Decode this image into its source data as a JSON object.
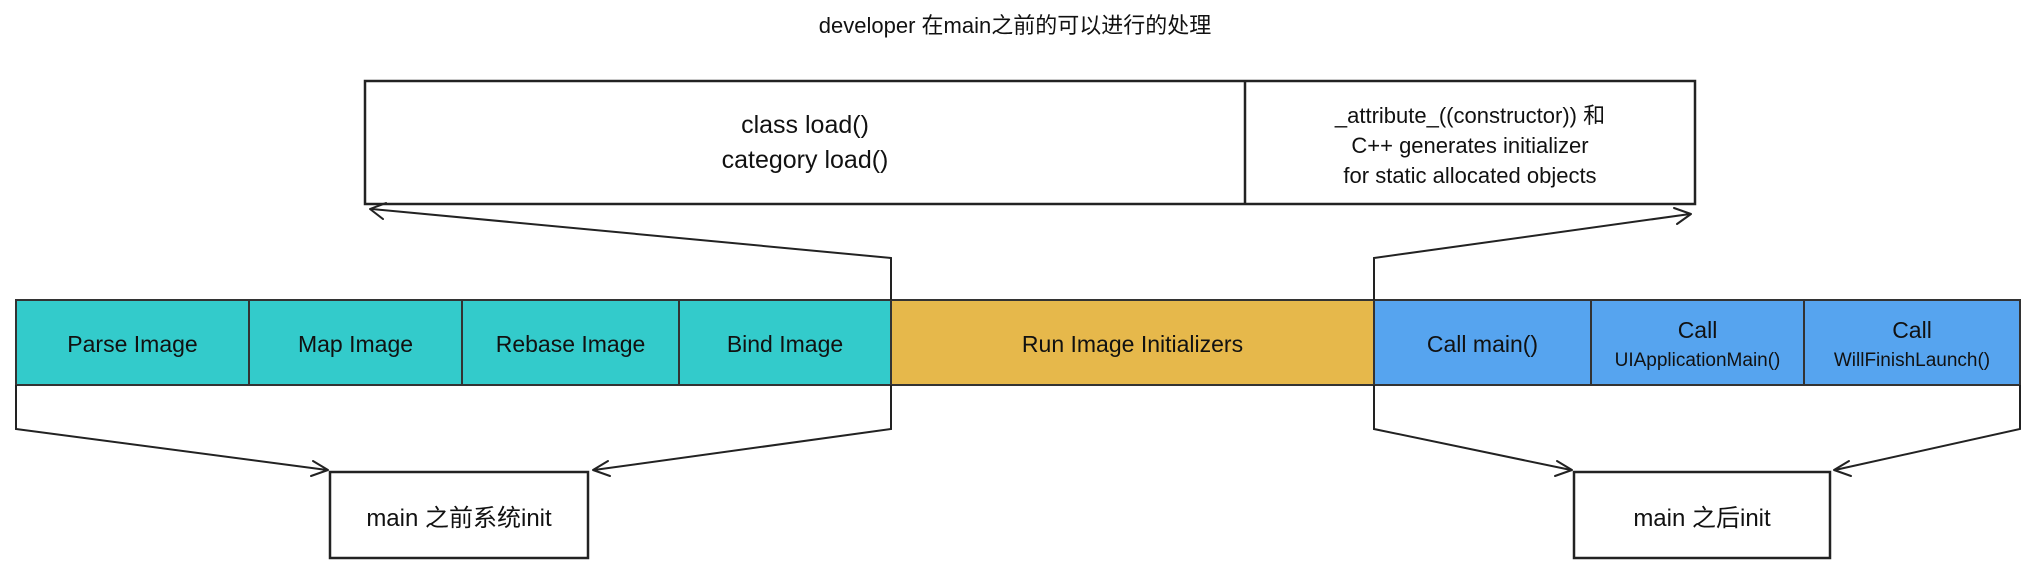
{
  "title": "developer 在main之前的可以进行的处理",
  "colors": {
    "teal": "#33cbcb",
    "gold": "#e6b84b",
    "blue": "#56a4ef",
    "border": "#222222"
  },
  "top_box": {
    "left_lines": [
      "class load()",
      "category load()"
    ],
    "right_lines": [
      "_attribute_((constructor)) 和",
      "C++ generates initializer",
      "for static allocated objects"
    ]
  },
  "pipeline": [
    {
      "lines": [
        "Parse Image"
      ],
      "color": "teal"
    },
    {
      "lines": [
        "Map Image"
      ],
      "color": "teal"
    },
    {
      "lines": [
        "Rebase Image"
      ],
      "color": "teal"
    },
    {
      "lines": [
        "Bind Image"
      ],
      "color": "teal"
    },
    {
      "lines": [
        "Run Image Initializers"
      ],
      "color": "gold"
    },
    {
      "lines": [
        "Call main()"
      ],
      "color": "blue"
    },
    {
      "lines": [
        "Call",
        "UIApplicationMain()"
      ],
      "color": "blue"
    },
    {
      "lines": [
        "Call",
        "WillFinishLaunch()"
      ],
      "color": "blue"
    }
  ],
  "bottom_boxes": {
    "before": "main 之前系统init",
    "after": "main 之后init"
  }
}
